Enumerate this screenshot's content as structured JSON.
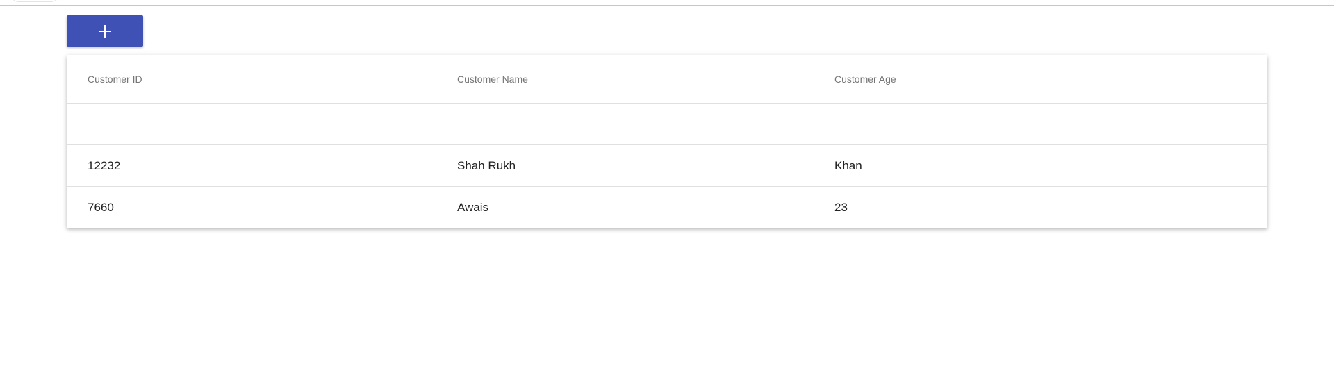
{
  "toolbar": {
    "add_button_icon": "plus-icon",
    "accent_color": "#3f51b5"
  },
  "table": {
    "columns": [
      "Customer ID",
      "Customer Name",
      "Customer Age"
    ],
    "rows": [
      [
        "",
        "",
        ""
      ],
      [
        "12232",
        "Shah Rukh",
        "Khan"
      ],
      [
        "7660",
        "Awais",
        "23"
      ]
    ]
  }
}
